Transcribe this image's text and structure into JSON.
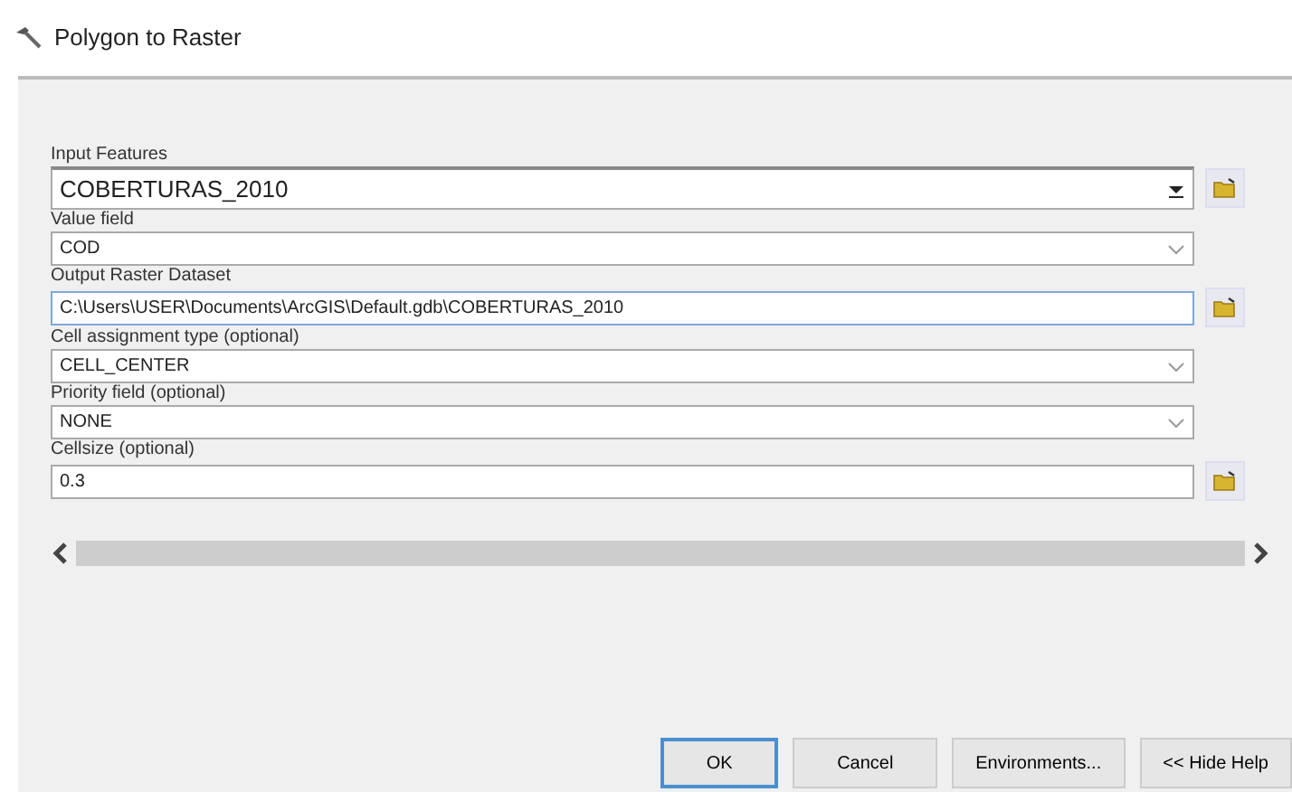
{
  "window": {
    "title": "Polygon to Raster"
  },
  "parameters": [
    {
      "label": "Input Features",
      "value": "COBERTURAS_2010",
      "kind": "combo-browse",
      "focused": false
    },
    {
      "label": "Value field",
      "value": "COD",
      "kind": "select",
      "focused": false
    },
    {
      "label": "Output Raster Dataset",
      "value": "C:\\Users\\USER\\Documents\\ArcGIS\\Default.gdb\\COBERTURAS_2010",
      "kind": "text-browse",
      "focused": true
    },
    {
      "label": "Cell assignment type (optional)",
      "value": "CELL_CENTER",
      "kind": "select",
      "focused": false
    },
    {
      "label": "Priority field (optional)",
      "value": "NONE",
      "kind": "select",
      "focused": false
    },
    {
      "label": "Cellsize (optional)",
      "value": "0.3",
      "kind": "text-browse",
      "focused": false
    }
  ],
  "buttons": [
    {
      "label": "OK",
      "selected": true
    },
    {
      "label": "Cancel",
      "selected": false
    },
    {
      "label": "Environments...",
      "selected": false
    },
    {
      "label": "<< Hide Help",
      "selected": false
    }
  ]
}
